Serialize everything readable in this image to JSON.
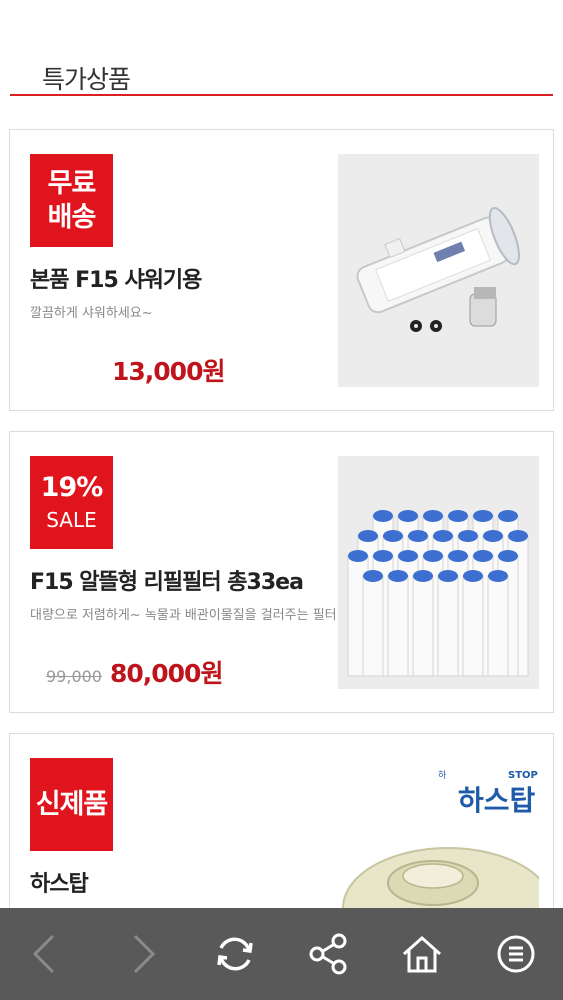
{
  "section": {
    "title": "특가상품"
  },
  "products": [
    {
      "badge_line1": "무료",
      "badge_line2": "배송",
      "name": "본품 F15 샤워기용",
      "description": "깔끔하게 샤워하세요~",
      "original_price": "",
      "price": "13,000원",
      "image": "shower-filter-product-photo"
    },
    {
      "badge_line1": "19%",
      "badge_line2": "SALE",
      "name": "F15 알뜰형 리필필터 총33ea",
      "description": "대량으로 저렴하게~ 녹물과 배관이물질을 걸러주는 필터",
      "original_price": "99,000",
      "price": "80,000원",
      "image": "refill-filters-product-photo"
    },
    {
      "badge_line1": "신제품",
      "badge_line2": "",
      "name": "하스탑",
      "description": "",
      "original_price": "",
      "price": "",
      "image_logo_small": "하",
      "image_logo_stop": "STOP",
      "image_logo_main": "하스탑",
      "image": "haseutap-product-photo"
    }
  ],
  "toolbar": {
    "buttons": [
      "back-icon",
      "forward-icon",
      "refresh-icon",
      "share-icon",
      "home-icon",
      "menu-icon"
    ]
  },
  "colors": {
    "accent": "#e0141c",
    "price": "#c0141c",
    "toolbar": "#595959"
  }
}
